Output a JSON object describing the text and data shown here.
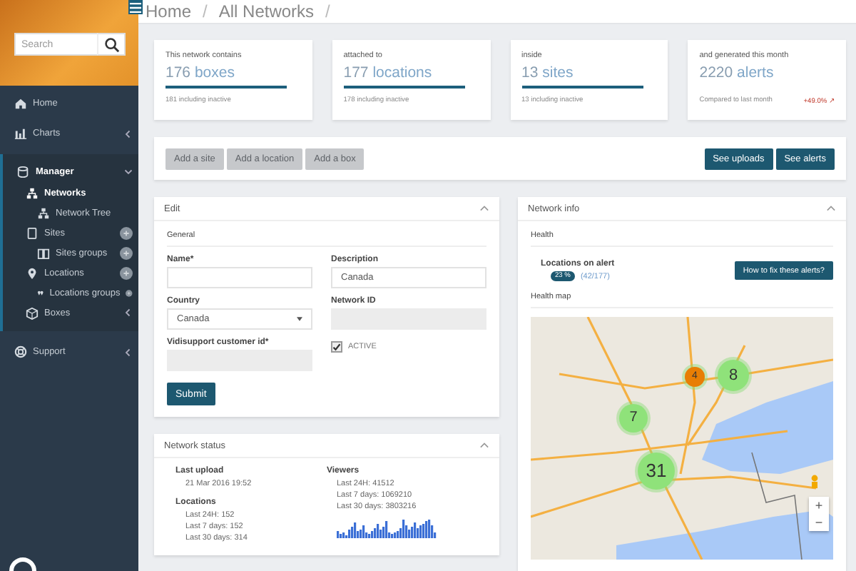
{
  "sidebar": {
    "search": {
      "placeholder": "Search"
    },
    "items": [
      {
        "label": "Home",
        "selected": false
      },
      {
        "label": "Charts",
        "selected": false,
        "expanded": false
      },
      {
        "label": "Manager",
        "expanded": true,
        "children": [
          {
            "label": "Networks",
            "selected": true,
            "children": [
              {
                "label": "Network Tree",
                "selected": false
              }
            ]
          },
          {
            "label": "Sites",
            "selected": false,
            "addable": true,
            "children": [
              {
                "label": "Sites groups",
                "selected": false,
                "addable": true
              }
            ]
          },
          {
            "label": "Locations",
            "selected": false,
            "addable": true,
            "children": [
              {
                "label": "Locations groups",
                "selected": false,
                "addable": true
              }
            ]
          },
          {
            "label": "Boxes",
            "selected": false,
            "expanded": false
          }
        ]
      },
      {
        "label": "Support",
        "selected": false,
        "expanded": false
      }
    ]
  },
  "breadcrumb": [
    {
      "label": "Home",
      "separator": "/"
    },
    {
      "label": "All Networks",
      "separator": "/"
    }
  ],
  "stats": [
    {
      "caption": "This network contains",
      "number": "176",
      "unit": "boxes",
      "note": "181 including inactive"
    },
    {
      "caption": "attached to",
      "number": "177",
      "unit": "locations",
      "note": "178 including inactive"
    },
    {
      "caption": "inside",
      "number": "13",
      "unit": "sites",
      "note": "13 including inactive"
    },
    {
      "caption": "and generated this month",
      "number": "2220",
      "unit": "alerts",
      "note": "Compared to last month",
      "change": "+49.0% ↗"
    }
  ],
  "toolbar": {
    "left": [
      {
        "label": "Add a site",
        "disabled": true
      },
      {
        "label": "Add a location",
        "disabled": true
      },
      {
        "label": "Add a box",
        "disabled": true
      }
    ],
    "right": [
      {
        "label": "See uploads",
        "disabled": false
      },
      {
        "label": "See alerts",
        "disabled": false
      }
    ]
  },
  "edit_panel": {
    "title": "Edit",
    "section": "General",
    "fields": [
      {
        "kind": "text",
        "label": "Name*"
      },
      {
        "kind": "textarea",
        "label": "Description",
        "value": "Canada"
      },
      {
        "kind": "select",
        "label": "Country",
        "value": "Canada"
      },
      {
        "kind": "readonly",
        "label": "Network ID"
      },
      {
        "kind": "readonly",
        "label": "Vidisupport customer id*"
      },
      {
        "kind": "checkbox",
        "label": "ACTIVE",
        "checked": true
      }
    ],
    "submit": "Submit"
  },
  "status_panel": {
    "title": "Network status",
    "last_upload_label": "Last upload",
    "last_upload": "21 Mar 2016 19:52",
    "locations_label": "Locations",
    "locations": [
      "Last 24H: 152",
      "Last 7 days: 152",
      "Last 30 days: 314"
    ],
    "viewers_label": "Viewers",
    "viewers": [
      "Last 24H: 41512",
      "Last 7 days: 1069210",
      "Last 30 days: 3803216"
    ]
  },
  "info_panel": {
    "title": "Network info",
    "health_label": "Health",
    "alert_label": "Locations on alert",
    "alert_percent": "23 %",
    "alert_count": "(42/177)",
    "fix_button": "How to fix these alerts?",
    "map_label": "Health map",
    "markers": [
      {
        "label": "4",
        "color": "#e87e04"
      },
      {
        "label": "8",
        "color": "#8fe27a"
      },
      {
        "label": "7",
        "color": "#8fe27a"
      },
      {
        "label": "31",
        "color": "#8fe27a"
      }
    ],
    "zoom_in": "+",
    "zoom_out": "−"
  }
}
